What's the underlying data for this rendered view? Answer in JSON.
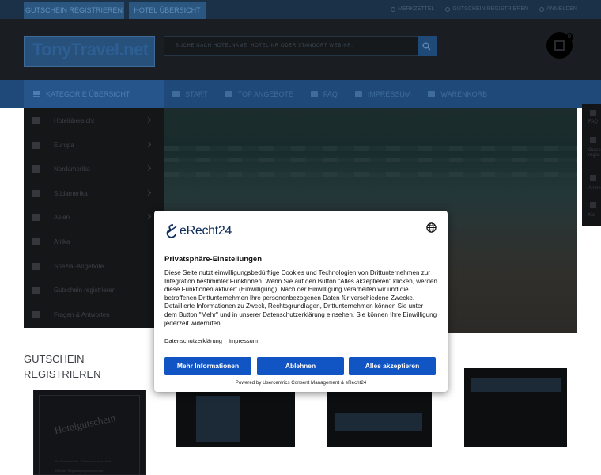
{
  "topbar": {
    "tabs": [
      "GUTSCHEIN REGISTRIEREN",
      "HOTEL ÜBERSICHT"
    ],
    "links": [
      "MERKZETTEL",
      "GUTSCHEIN REGISTRIEREN",
      "ANMELDEN"
    ]
  },
  "header": {
    "logo_text": "TonyTravel.net",
    "search_placeholder": "SUCHE NACH HOTELNAME, HOTEL-NR ODER STANDORT WEB-NR.",
    "cart_count": "0"
  },
  "nav": {
    "category_label": "KATEGORIE ÜBERSICHT",
    "links": [
      "START",
      "TOP ANGEBOTE",
      "FAQ",
      "IMPRESSUM",
      "WARENKORB"
    ]
  },
  "sidebar": {
    "items": [
      {
        "label": "Hotelübersicht",
        "chevron": true
      },
      {
        "label": "Europa",
        "chevron": true
      },
      {
        "label": "Nordamerika",
        "chevron": true
      },
      {
        "label": "Südamerika",
        "chevron": true
      },
      {
        "label": "Asien",
        "chevron": true
      },
      {
        "label": "Afrika",
        "chevron": false
      },
      {
        "label": "Spezial-Angebote",
        "chevron": false
      },
      {
        "label": "Gutschein registrieren",
        "chevron": false
      },
      {
        "label": "Fragen & Antworten",
        "chevron": false
      }
    ]
  },
  "right_tools": [
    "FAQ",
    "Gutsc regist",
    "Anme",
    "Kar"
  ],
  "section": {
    "title": "GUTSCHEIN REGISTRIEREN",
    "voucher_title": "Hotelgutschein",
    "voucher_lines": [
      "Ihr Gutschein für 2 Personen zum Hotel",
      "Bitte die Registrierungsnummer an"
    ]
  },
  "cookie": {
    "brand": "eRecht24",
    "title": "Privatsphäre-Einstellungen",
    "body": "Diese Seite nutzt einwilligungsbedürftige Cookies und Technologien von Drittunternehmen zur Integration bestimmter Funktionen. Wenn Sie auf den Button \"Alles akzeptieren\" klicken, werden diese Funktionen aktiviert (Einwilligung). Nach der Einwilligung verarbeiten wir und die betroffenen Drittunternehmen Ihre personenbezogenen Daten für verschiedene Zwecke. Detaillierte Informationen zu Zweck, Rechtsgrundlagen, Drittunternehmen können Sie unter dem Button \"Mehr\" und in unserer Datenschutzerklärung einsehen. Sie können Ihre Einwilligung jederzeit widerrufen.",
    "link_privacy": "Datenschutzerklärung",
    "link_imprint": "Impressum",
    "btn_more": "Mehr Informationen",
    "btn_reject": "Ablehnen",
    "btn_accept": "Alles akzeptieren",
    "footer": "Powered by Usercentrics Consent Management & eRecht24",
    "accent": "#1155c5"
  }
}
